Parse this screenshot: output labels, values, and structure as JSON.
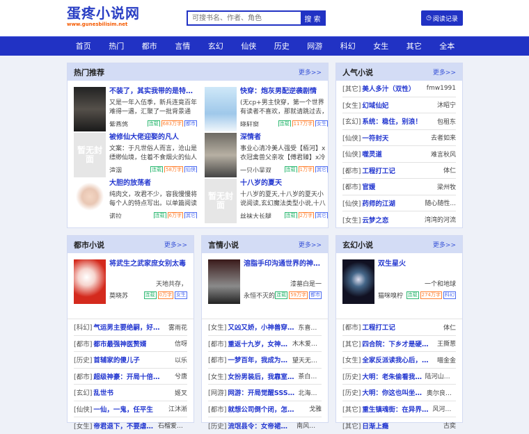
{
  "site": {
    "name": "蛋疼小说网",
    "url": "www.gunesbilisim.net"
  },
  "search": {
    "placeholder": "可搜书名、作者、角色",
    "button": "搜 索"
  },
  "history_button": "阅读记录",
  "nav": [
    "首页",
    "热门",
    "都市",
    "言情",
    "玄幻",
    "仙侠",
    "历史",
    "网游",
    "科幻",
    "女生",
    "其它",
    "全本"
  ],
  "more": "更多>>",
  "no_cover": "暂无封面",
  "hot": {
    "title": "热门推荐",
    "books": [
      {
        "title": "不装了，其实我带的是特种...",
        "desc": "又是一年入伍季，新兵连竟百年难得一遇，汇聚了一批背景通",
        "author": "紫燕悠",
        "status": "连载",
        "words": "683万字",
        "cat": "都市",
        "cover": "dark"
      },
      {
        "title": "快穿：炮灰男配逆袭剧情",
        "desc": "(无cp+男主快穿，第一个世界有读者不喜欢，那就请跳过去，再",
        "author": "晓轩窗",
        "status": "连载",
        "words": "117万字",
        "cat": "女生",
        "cover": "light"
      },
      {
        "title": "被修仙大佬迎娶的凡人",
        "desc": "文案：于凡世俗人而言，沧山是缥缈仙境，住着不食烟火的仙人",
        "author": "渲洇",
        "status": "连载",
        "words": "58万字",
        "cat": "仙侠",
        "cover": "none"
      },
      {
        "title": "深情者",
        "desc": "事业心清冷美人强受【栢河】x衣冠禽兽父亲攻【傅君臻】x冷漠深",
        "author": "一只小吴双",
        "status": "连载",
        "words": "1万字",
        "cat": "其它",
        "cover": "gray"
      },
      {
        "title": "大胆的放荡者",
        "desc": "纯肉文，攻君不少，容我慢慢将每个人的特点写出。以单篇阅读",
        "author": "诺拉",
        "status": "连载",
        "words": "6万字",
        "cat": "其它",
        "cover": "anime"
      },
      {
        "title": "十八岁的夏天",
        "desc": "十八岁的夏天,十八岁的夏天小说阅读,玄幻魔法类型小说,十八岁的",
        "author": "丝袜大长腿",
        "status": "连载",
        "words": "2万字",
        "cat": "其它",
        "cover": "none"
      }
    ]
  },
  "popular": {
    "title": "人气小说",
    "items": [
      {
        "cat": "[其它]",
        "name": "美人多汁（双性）",
        "author": "fmw1991"
      },
      {
        "cat": "[女生]",
        "name": "幻域仙妃",
        "author": "沐昭宁"
      },
      {
        "cat": "[玄幻]",
        "name": "系统：稳住，别浪！",
        "author": "包租东"
      },
      {
        "cat": "[仙侠]",
        "name": "一符封天",
        "author": "去者如来"
      },
      {
        "cat": "[仙侠]",
        "name": "噬灵道",
        "author": "难言秋风"
      },
      {
        "cat": "[都市]",
        "name": "工程打工记",
        "author": "体仁"
      },
      {
        "cat": "[都市]",
        "name": "官媛",
        "author": "梁州牧"
      },
      {
        "cat": "[仙侠]",
        "name": "药师的江湖",
        "author": "随心随性..."
      },
      {
        "cat": "[女生]",
        "name": "云梦之恋",
        "author": "湾湾的河流"
      }
    ]
  },
  "sections": [
    {
      "title": "都市小说",
      "feature": {
        "title": "将武生之武家庶女别太毒",
        "desc": "天地共存，",
        "author": "莫晓苏",
        "status": "连载",
        "words": "0万字",
        "cat": "女生",
        "cover": "red"
      },
      "items": [
        {
          "cat": "[科幻]",
          "name": "气运男主要绝嗣，好孕女...",
          "author": "雾雨花"
        },
        {
          "cat": "[都市]",
          "name": "都市最强神医赘婿",
          "author": "信呀"
        },
        {
          "cat": "[历史]",
          "name": "首辅家的傻儿子",
          "author": "以乐"
        },
        {
          "cat": "[都市]",
          "name": "超级神豪：开局十倍返现",
          "author": "兮唐"
        },
        {
          "cat": "[玄幻]",
          "name": "乱世书",
          "author": "姬叉"
        },
        {
          "cat": "[仙侠]",
          "name": "一仙，一鬼，任平生",
          "author": "江沐淅"
        },
        {
          "cat": "[女生]",
          "name": "帝君退下，不要虐让...",
          "author": "石榴爱上橙"
        }
      ]
    },
    {
      "title": "言情小说",
      "feature": {
        "title": "溶脂手印沟通世界的神秘...",
        "desc": "漆墓白是一",
        "author": "永恒不灭的",
        "status": "连载",
        "words": "59万字",
        "cat": "都市",
        "cover": "mist"
      },
      "items": [
        {
          "cat": "[女生]",
          "name": "又凶又娇，小神兽穿书...",
          "author": "东喜南北"
        },
        {
          "cat": "[都市]",
          "name": "重返十九岁，女神你...",
          "author": "木木爱吃鱼"
        },
        {
          "cat": "[都市]",
          "name": "一梦百年，我成为了...",
          "author": "望天无敌手"
        },
        {
          "cat": "[女生]",
          "name": "女扮男装后，我靠室友...",
          "author": "茶白墨黑"
        },
        {
          "cat": "[网游]",
          "name": "网游：开局觉醒SSS无...",
          "author": "北海的鱼"
        },
        {
          "cat": "[都市]",
          "name": "就想公司倒个闭，怎么这么难",
          "author": "戈雅"
        },
        {
          "cat": "[历史]",
          "name": "流氓县令：女帝裙下臣",
          "author": "南风听雨"
        }
      ]
    },
    {
      "title": "玄幻小说",
      "feature": {
        "title": "双生星火",
        "desc": "一个和地球",
        "author": "猫咪嗅柠",
        "status": "连载",
        "words": "274万字",
        "cat": "科幻",
        "cover": "space"
      },
      "items": [
        {
          "cat": "[都市]",
          "name": "工程打工记",
          "author": "体仁"
        },
        {
          "cat": "[其它]",
          "name": "四合院：下乡才是硬道理",
          "author": "王撕葱"
        },
        {
          "cat": "[女生]",
          "name": "全家反派读我心后，人设...",
          "author": "喵金金"
        },
        {
          "cat": "[历史]",
          "name": "大明：老朱偷看我...",
          "author": "陆河山的..."
        },
        {
          "cat": "[历史]",
          "name": "大明：你这也叫坐牢...",
          "author": "奥尔良烤猫"
        },
        {
          "cat": "[其它]",
          "name": "重生镇魂街：在异界成...",
          "author": "风河溪竹"
        },
        {
          "cat": "[其它]",
          "name": "日渐上瘾",
          "author": "古奕"
        }
      ]
    }
  ],
  "colors": {
    "brand": "#2132c4",
    "title": "#2438d0",
    "status": "#2eb872",
    "words": "#ff8233",
    "category": "#4d6cf0"
  }
}
